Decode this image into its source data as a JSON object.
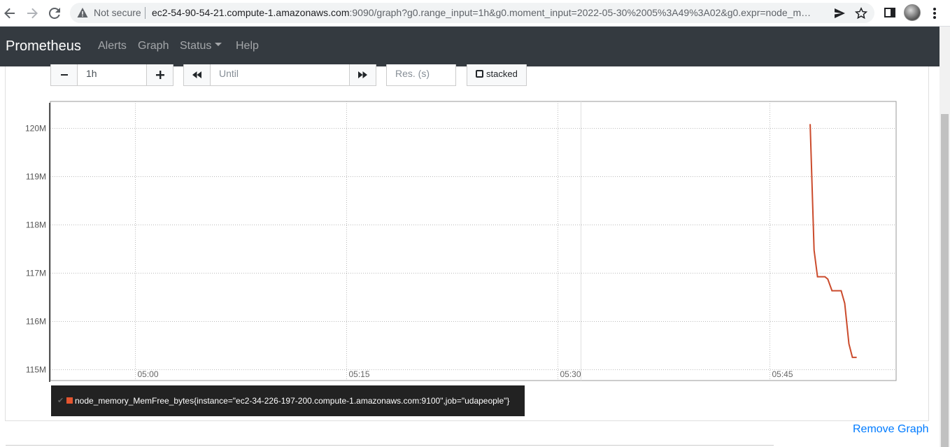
{
  "browser": {
    "security_label": "Not secure",
    "url_host": "ec2-54-90-54-21.compute-1.amazonaws.com",
    "url_path": ":9090/graph?g0.range_input=1h&g0.moment_input=2022-05-30%2005%3A49%3A02&g0.expr=node_m…"
  },
  "navbar": {
    "brand": "Prometheus",
    "links": [
      "Alerts",
      "Graph",
      "Status",
      "Help"
    ]
  },
  "controls": {
    "minus_label": "−",
    "range_value": "1h",
    "plus_label": "+",
    "until_placeholder": "Until",
    "res_placeholder": "Res. (s)",
    "stacked_label": "stacked"
  },
  "chart_data": {
    "type": "line",
    "ylim": [
      114.77,
      120.55
    ],
    "x_range": [
      "04:54",
      "05:54"
    ],
    "y_ticks": [
      {
        "value": 115,
        "label": "115M"
      },
      {
        "value": 116,
        "label": "116M"
      },
      {
        "value": 117,
        "label": "117M"
      },
      {
        "value": 118,
        "label": "118M"
      },
      {
        "value": 119,
        "label": "119M"
      },
      {
        "value": 120,
        "label": "120M"
      }
    ],
    "x_ticks": [
      {
        "minutes": 6.0,
        "label": "05:00"
      },
      {
        "minutes": 21.0,
        "label": "05:15"
      },
      {
        "minutes": 36.0,
        "label": "05:30"
      },
      {
        "minutes": 51.0,
        "label": "05:45"
      }
    ],
    "color": "#cb4b2c",
    "series": [
      {
        "name": "node_memory_MemFree_bytes{instance=\"ec2-34-226-197-200.compute-1.amazonaws.com:9100\",job=\"udapeople\"}",
        "points": [
          [
            53.9,
            120.08
          ],
          [
            54.18,
            117.47
          ],
          [
            54.42,
            116.92
          ],
          [
            54.95,
            116.92
          ],
          [
            55.15,
            116.87
          ],
          [
            55.45,
            116.63
          ],
          [
            56.1,
            116.63
          ],
          [
            56.35,
            116.37
          ],
          [
            56.65,
            115.53
          ],
          [
            56.9,
            115.25
          ],
          [
            57.2,
            115.25
          ]
        ]
      }
    ]
  },
  "legend": {
    "check": "✔",
    "label": "node_memory_MemFree_bytes{instance=\"ec2-34-226-197-200.compute-1.amazonaws.com:9100\",job=\"udapeople\"}"
  },
  "remove_graph_label": "Remove Graph"
}
